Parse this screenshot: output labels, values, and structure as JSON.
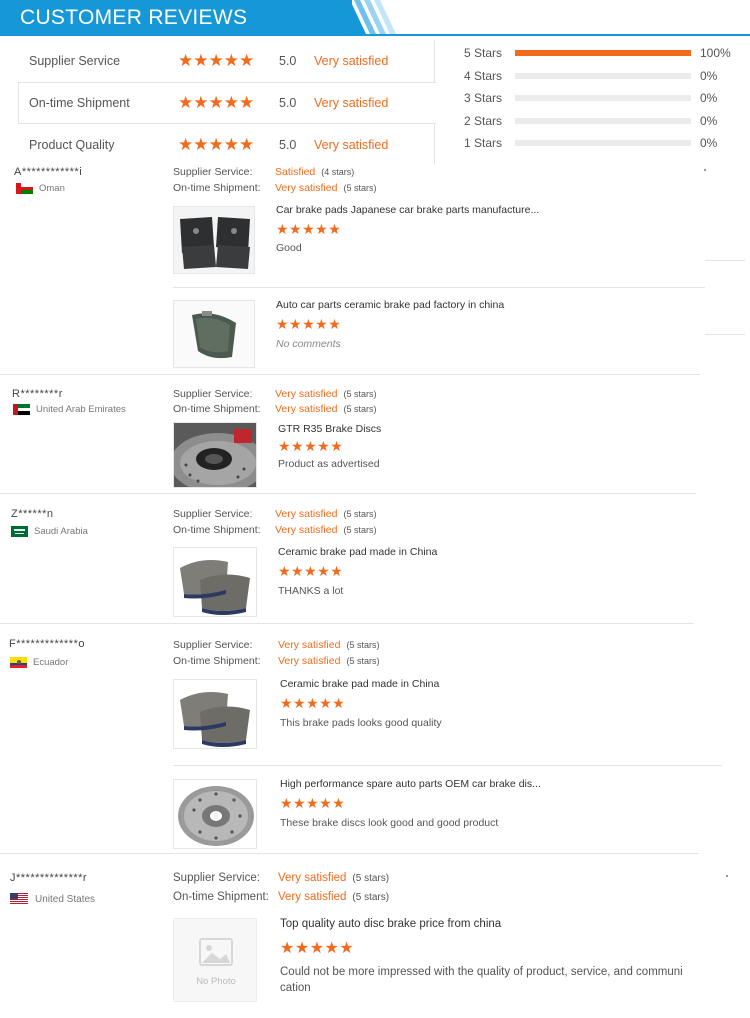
{
  "header": {
    "title": "CUSTOMER REVIEWS"
  },
  "summary": [
    {
      "label": "Supplier Service",
      "stars": "★★★★★",
      "score": "5.0",
      "verdict": "Very satisfied"
    },
    {
      "label": "On-time Shipment",
      "stars": "★★★★★",
      "score": "5.0",
      "verdict": "Very satisfied"
    },
    {
      "label": "Product Quality",
      "stars": "★★★★★",
      "score": "5.0",
      "verdict": "Very satisfied"
    }
  ],
  "distribution": [
    {
      "label": "5 Stars",
      "percent": "100%",
      "fraction": 1.0
    },
    {
      "label": "4 Stars",
      "percent": "0%",
      "fraction": 0
    },
    {
      "label": "3 Stars",
      "percent": "0%",
      "fraction": 0
    },
    {
      "label": "2 Stars",
      "percent": "0%",
      "fraction": 0
    },
    {
      "label": "1 Stars",
      "percent": "0%",
      "fraction": 0
    }
  ],
  "colors": {
    "brand_blue": "#1597d8",
    "accent_orange": "#f26b1d"
  },
  "reviews": [
    {
      "user": "A************i",
      "country": "Oman",
      "flag": "oman-flag",
      "supplier_label": "Supplier Service:",
      "supplier_value": "Satisfied",
      "supplier_count": "(4 stars)",
      "shipment_label": "On-time Shipment:",
      "shipment_value": "Very satisfied",
      "shipment_count": "(5 stars)",
      "products": [
        {
          "title": "Car brake pads Japanese car brake parts manufacture...",
          "stars": "★★★★★",
          "comment": "Good",
          "image": "brake-pads-image"
        },
        {
          "title": "Auto car parts ceramic brake pad factory in china",
          "stars": "★★★★★",
          "comment": "No comments",
          "image": "brake-pad-single-image"
        }
      ]
    },
    {
      "user": "R********r",
      "country": "United Arab Emirates",
      "flag": "uae-flag",
      "supplier_label": "Supplier Service:",
      "supplier_value": "Very satisfied",
      "supplier_count": "(5 stars)",
      "shipment_label": "On-time Shipment:",
      "shipment_value": "Very satisfied",
      "shipment_count": "(5 stars)",
      "products": [
        {
          "title": "GTR R35 Brake Discs",
          "stars": "★★★★★",
          "comment": "Product as advertised",
          "image": "brake-disc-image"
        }
      ]
    },
    {
      "user": "Z******n",
      "country": "Saudi Arabia",
      "flag": "saudi-flag",
      "supplier_label": "Supplier Service:",
      "supplier_value": "Very satisfied",
      "supplier_count": "(5 stars)",
      "shipment_label": "On-time Shipment:",
      "shipment_value": "Very satisfied",
      "shipment_count": "(5 stars)",
      "products": [
        {
          "title": "Ceramic brake pad made in China",
          "stars": "★★★★★",
          "comment": "THANKS a lot",
          "image": "ceramic-pads-image"
        }
      ]
    },
    {
      "user": "F*************o",
      "country": "Ecuador",
      "flag": "ecuador-flag",
      "supplier_label": "Supplier Service:",
      "supplier_value": "Very satisfied",
      "supplier_count": "(5 stars)",
      "shipment_label": "On-time Shipment:",
      "shipment_value": "Very satisfied",
      "shipment_count": "(5 stars)",
      "products": [
        {
          "title": "Ceramic brake pad made in China",
          "stars": "★★★★★",
          "comment": "This brake pads looks good quality",
          "image": "ceramic-pads-image"
        },
        {
          "title": "High performance spare auto parts OEM car brake dis...",
          "stars": "★★★★★",
          "comment": "These brake discs look good and good product",
          "image": "drilled-disc-image"
        }
      ]
    },
    {
      "user": "J**************r",
      "country": "United States",
      "flag": "usa-flag",
      "supplier_label": "Supplier Service:",
      "supplier_value": "Very satisfied",
      "supplier_count": "(5 stars)",
      "shipment_label": "On-time Shipment:",
      "shipment_value": "Very satisfied",
      "shipment_count": "(5 stars)",
      "products": [
        {
          "title": "Top quality auto disc brake price from china",
          "stars": "★★★★★",
          "comment_line1": "Could not be more impressed with the quality of product, service, and communi",
          "comment_line2": "cation",
          "image": "no-photo-placeholder",
          "no_photo_label": "No Photo"
        }
      ]
    }
  ]
}
